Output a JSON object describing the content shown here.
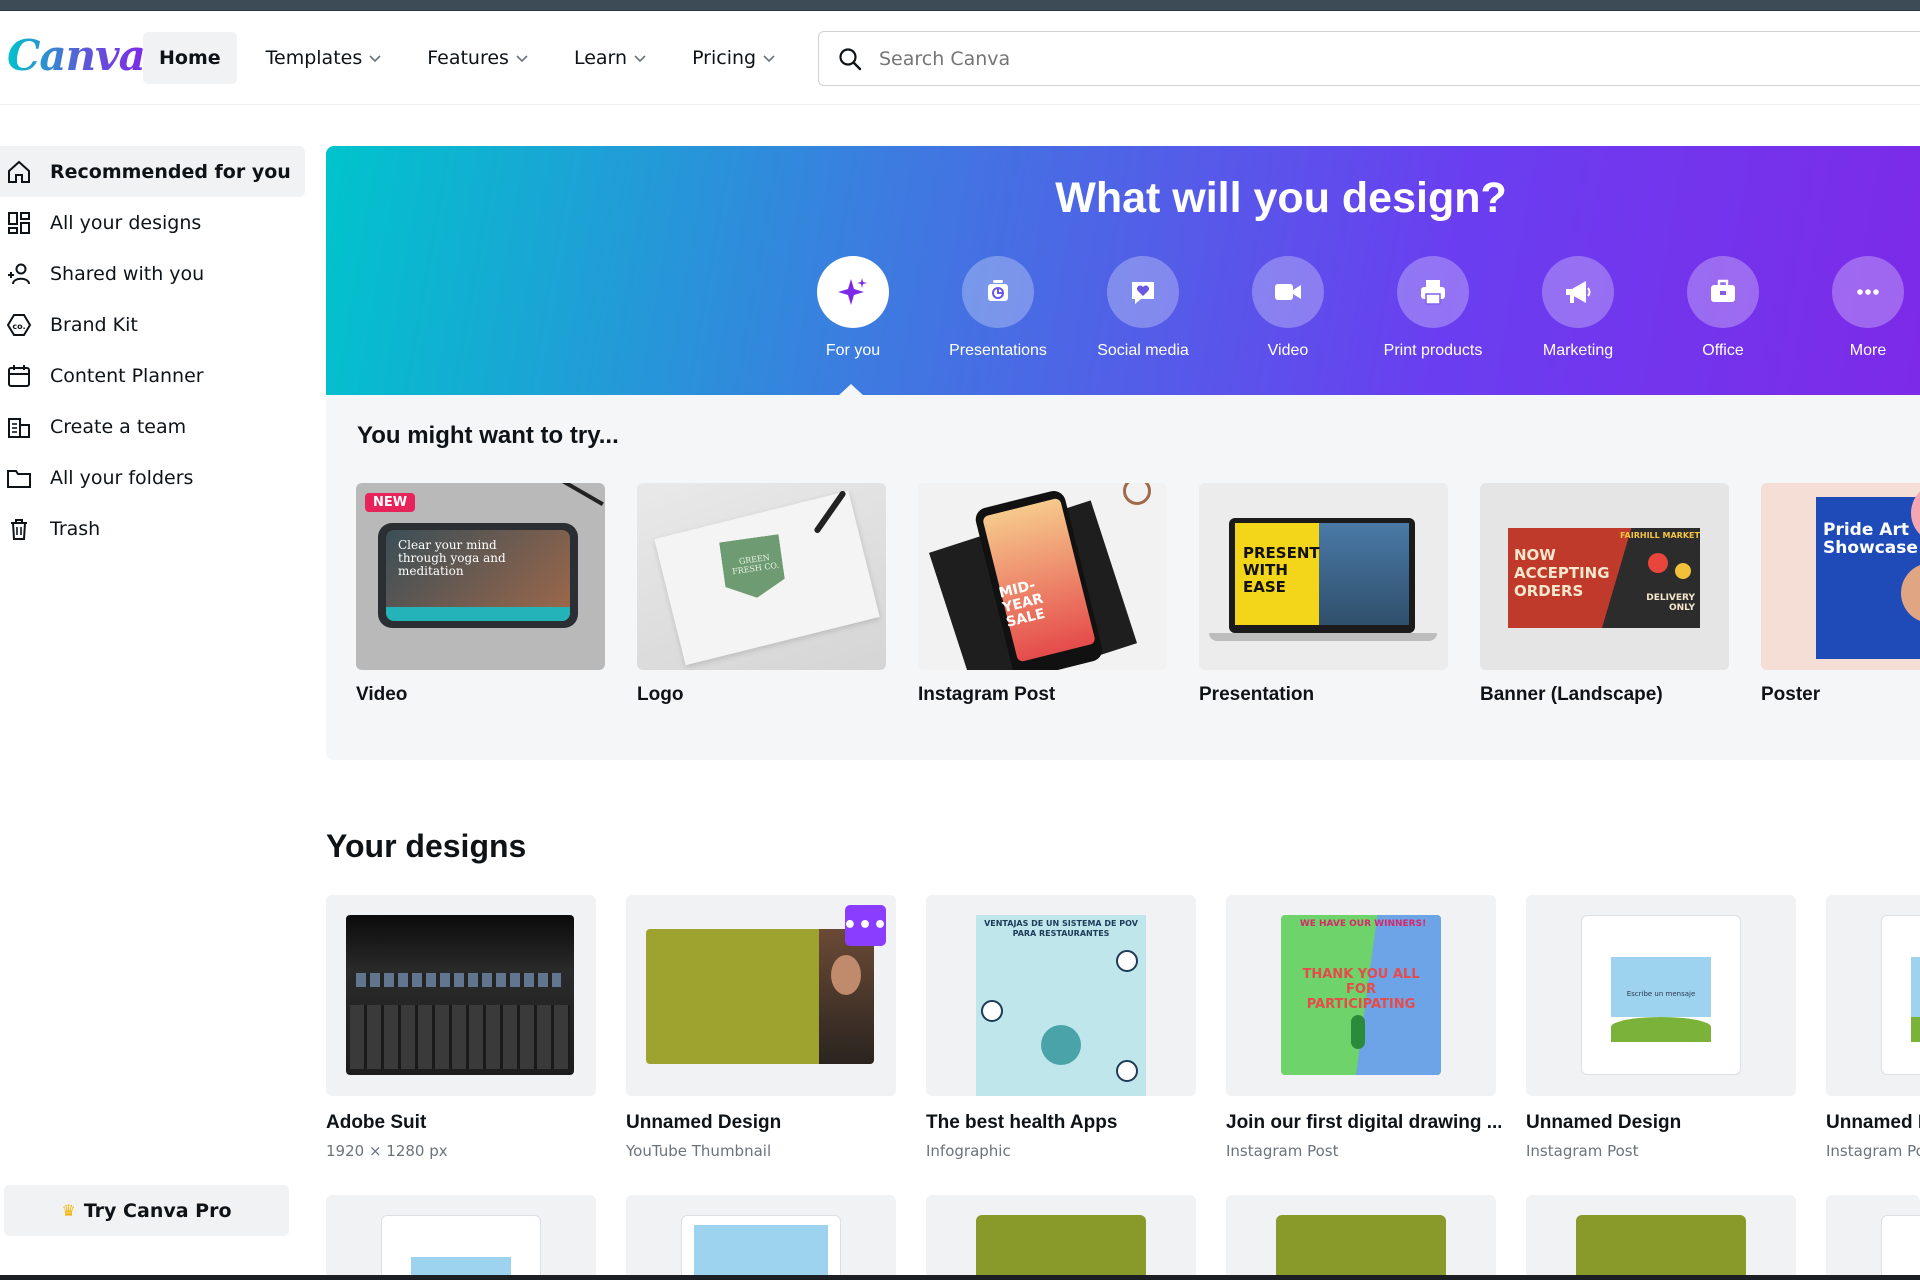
{
  "header": {
    "logo": "Canva",
    "nav": [
      {
        "label": "Home"
      },
      {
        "label": "Templates"
      },
      {
        "label": "Features"
      },
      {
        "label": "Learn"
      },
      {
        "label": "Pricing"
      }
    ],
    "search_placeholder": "Search Canva"
  },
  "sidebar": {
    "items": [
      {
        "label": "Recommended for you",
        "icon": "home-icon"
      },
      {
        "label": "All your designs",
        "icon": "grid-icon"
      },
      {
        "label": "Shared with you",
        "icon": "people-icon"
      },
      {
        "label": "Brand Kit",
        "icon": "brand-kit-icon"
      },
      {
        "label": "Content Planner",
        "icon": "calendar-icon"
      },
      {
        "label": "Create a team",
        "icon": "building-icon"
      },
      {
        "label": "All your folders",
        "icon": "folder-icon"
      },
      {
        "label": "Trash",
        "icon": "trash-icon"
      }
    ],
    "try_pro": "Try Canva Pro"
  },
  "hero": {
    "title": "What will you design?",
    "categories": [
      {
        "label": "For you",
        "icon": "sparkle-icon"
      },
      {
        "label": "Presentations",
        "icon": "presentation-icon"
      },
      {
        "label": "Social media",
        "icon": "heart-chat-icon"
      },
      {
        "label": "Video",
        "icon": "video-camera-icon"
      },
      {
        "label": "Print products",
        "icon": "printer-icon"
      },
      {
        "label": "Marketing",
        "icon": "megaphone-icon"
      },
      {
        "label": "Office",
        "icon": "briefcase-icon"
      },
      {
        "label": "More",
        "icon": "more-dots-icon"
      }
    ]
  },
  "try": {
    "title": "You might want to try...",
    "badge": "NEW",
    "cards": [
      {
        "label": "Video",
        "thumb_text": "Clear your mind through yoga and meditation"
      },
      {
        "label": "Logo",
        "thumb_text": "GREEN FRESH CO."
      },
      {
        "label": "Instagram Post",
        "thumb_text": "MID-YEAR SALE"
      },
      {
        "label": "Presentation",
        "thumb_text": "PRESENT WITH EASE"
      },
      {
        "label": "Banner (Landscape)",
        "thumb_text": "NOW ACCEPTING ORDERS",
        "thumb_text2": "FAIRHILL MARKET",
        "thumb_text3": "DELIVERY ONLY"
      },
      {
        "label": "Poster",
        "thumb_text": "Pride Art Showcase"
      }
    ]
  },
  "designs": {
    "title": "Your designs",
    "items": [
      {
        "name": "Adobe Suit",
        "sub": "1920 × 1280 px"
      },
      {
        "name": "Unnamed Design",
        "sub": "YouTube Thumbnail"
      },
      {
        "name": "The best health Apps",
        "sub": "Infographic",
        "thumb_text": "VENTAJAS DE UN SISTEMA DE POV PARA RESTAURANTES"
      },
      {
        "name": "Join our first digital drawing ...",
        "sub": "Instagram Post",
        "thumb_text": "THANK YOU ALL FOR PARTICIPATING",
        "thumb_text2": "WE HAVE OUR WINNERS!"
      },
      {
        "name": "Unnamed Design",
        "sub": "Instagram Post",
        "thumb_text": "Escribe un mensaje"
      },
      {
        "name": "Unnamed Design",
        "sub": "Instagram Post"
      }
    ],
    "more_label": "•••"
  },
  "colors": {
    "brand_purple": "#7d2ae8",
    "brand_teal": "#00c4cc",
    "olive": "#9ea22f"
  }
}
